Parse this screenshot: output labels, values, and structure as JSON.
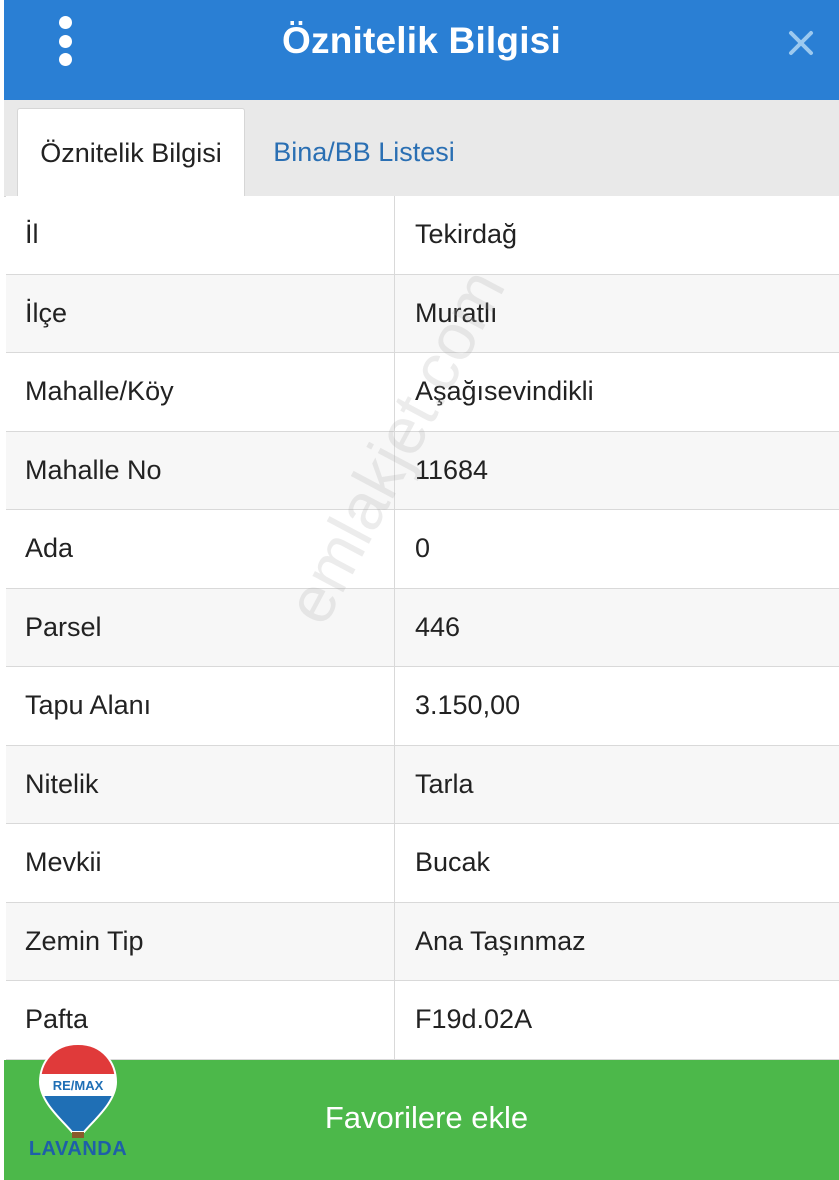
{
  "header": {
    "title": "Öznitelik Bilgisi",
    "background": "#2a7fd4"
  },
  "tabs": [
    {
      "label": "Öznitelik Bilgisi",
      "active": true
    },
    {
      "label": "Bina/BB Listesi",
      "active": false
    }
  ],
  "rows": [
    {
      "key": "İl",
      "value": "Tekirdağ"
    },
    {
      "key": "İlçe",
      "value": "Muratlı"
    },
    {
      "key": "Mahalle/Köy",
      "value": "Aşağısevindikli"
    },
    {
      "key": "Mahalle No",
      "value": "11684"
    },
    {
      "key": "Ada",
      "value": "0"
    },
    {
      "key": "Parsel",
      "value": "446"
    },
    {
      "key": "Tapu Alanı",
      "value": "3.150,00"
    },
    {
      "key": "Nitelik",
      "value": "Tarla"
    },
    {
      "key": "Mevkii",
      "value": "Bucak"
    },
    {
      "key": "Zemin Tip",
      "value": "Ana Taşınmaz"
    },
    {
      "key": "Pafta",
      "value": "F19d.02A"
    }
  ],
  "watermark": "emlakjet.com",
  "footer": {
    "button_label": "Favorilere ekle",
    "background": "#4cb84a"
  },
  "logo": {
    "badge_text": "RE/MAX",
    "name": "LAVANDA"
  },
  "icons": {
    "menu": "more-vertical-icon",
    "close": "close-icon"
  }
}
